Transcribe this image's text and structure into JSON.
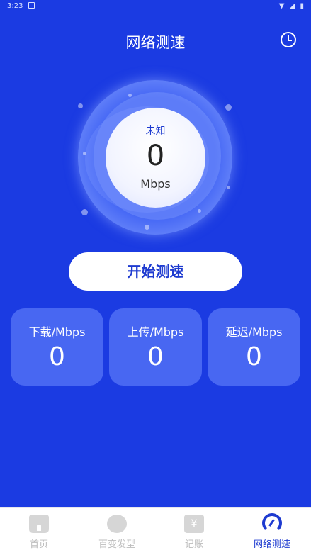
{
  "status_bar": {
    "time": "3:23",
    "icons": "▼ ◢ ▮"
  },
  "header": {
    "title": "网络测速"
  },
  "gauge": {
    "status": "未知",
    "speed": "0",
    "unit": "Mbps"
  },
  "start_button": {
    "label": "开始测速"
  },
  "metrics": [
    {
      "label": "下载/Mbps",
      "value": "0"
    },
    {
      "label": "上传/Mbps",
      "value": "0"
    },
    {
      "label": "延迟/Mbps",
      "value": "0"
    }
  ],
  "tabs": [
    {
      "label": "首页",
      "icon": "home-icon"
    },
    {
      "label": "百变发型",
      "icon": "hairstyle-icon"
    },
    {
      "label": "记账",
      "icon": "ledger-icon",
      "glyph": "¥"
    },
    {
      "label": "网络测速",
      "icon": "speedometer-icon",
      "active": true
    }
  ],
  "colors": {
    "background": "#1b3be2",
    "accent": "#1e3bd0",
    "inactive_tab": "#bdbdbd"
  }
}
